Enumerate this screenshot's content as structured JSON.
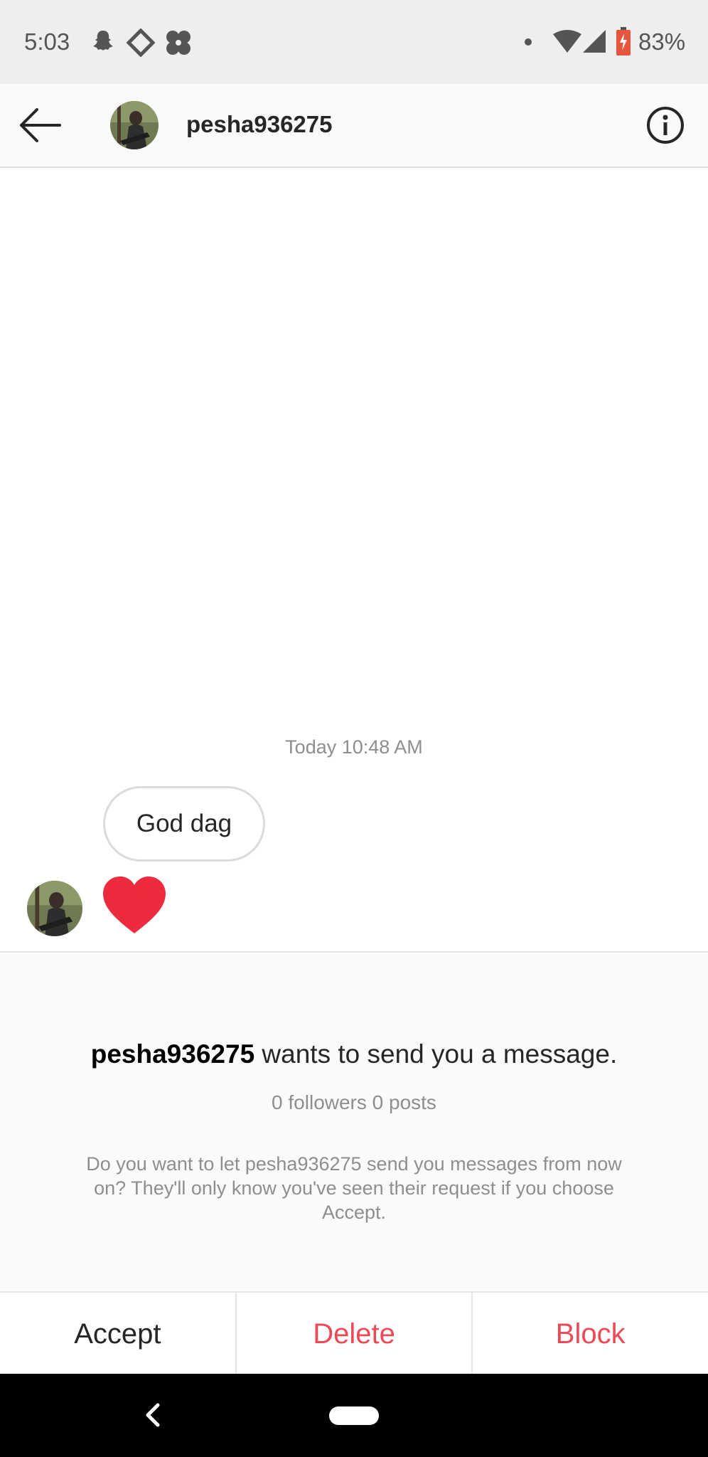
{
  "status_bar": {
    "time": "5:03",
    "icons": [
      "snapchat-icon",
      "diamond-nav-icon",
      "flower-icon",
      "dot-icon",
      "wifi-icon",
      "signal-icon",
      "battery-charging-icon"
    ],
    "battery": "83%"
  },
  "header": {
    "back_icon": "arrow-left-icon",
    "username": "pesha936275",
    "info_icon": "info-icon"
  },
  "chat": {
    "timestamp": "Today 10:48 AM",
    "messages": [
      {
        "type": "text",
        "text": "God dag"
      },
      {
        "type": "reaction",
        "icon": "heart-icon"
      }
    ]
  },
  "request": {
    "username": "pesha936275",
    "title_suffix": " wants to send you a message.",
    "stats": "0 followers 0 posts",
    "description": "Do you want to let pesha936275 send you messages from now on? They'll only know you've seen their request if you choose Accept."
  },
  "actions": {
    "accept": "Accept",
    "delete": "Delete",
    "block": "Block"
  },
  "colors": {
    "accent_red": "#ed4956",
    "heart_red": "#ed2b3f",
    "text_dark": "#262626",
    "text_gray": "#8e8e8e"
  }
}
